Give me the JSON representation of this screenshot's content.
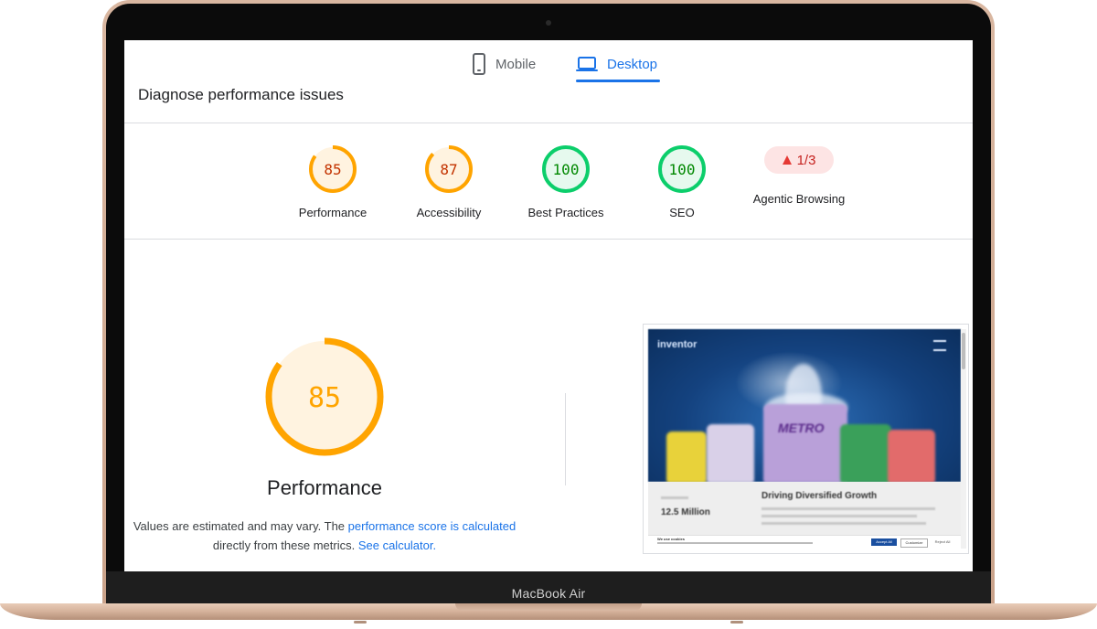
{
  "device": {
    "brand_label": "MacBook Air"
  },
  "tabs": [
    {
      "label": "Mobile",
      "icon": "phone-icon",
      "active": false
    },
    {
      "label": "Desktop",
      "icon": "laptop-icon",
      "active": true
    }
  ],
  "section_title": "Diagnose performance issues",
  "categories": [
    {
      "label": "Performance",
      "score": "85",
      "fraction": 0.85,
      "status": "average"
    },
    {
      "label": "Accessibility",
      "score": "87",
      "fraction": 0.87,
      "status": "average"
    },
    {
      "label": "Best Practices",
      "score": "100",
      "fraction": 1.0,
      "status": "pass"
    },
    {
      "label": "SEO",
      "score": "100",
      "fraction": 1.0,
      "status": "pass"
    },
    {
      "label": "Agentic Browsing",
      "score": "1/3",
      "status": "fail",
      "icon": "warning-triangle-icon"
    }
  ],
  "main": {
    "score": "85",
    "fraction": 0.85,
    "title": "Performance",
    "note_prefix": "Values are estimated and may vary. The ",
    "note_link1": "performance score is calculated",
    "note_middle": "directly from these metrics. ",
    "note_link2": "See calculator."
  },
  "colors": {
    "average_stroke": "#ffa400",
    "average_fill": "#fff3e0",
    "average_text": "#c33300",
    "pass_stroke": "#0cce6b",
    "pass_fill": "#e6f9ee",
    "pass_text": "#008800",
    "fail_fill": "#fde4e4",
    "fail_text": "#c5221f",
    "link": "#1a73e8"
  },
  "screenshot": {
    "logo": "inventor",
    "stat_label": "12.5 Million",
    "heading": "Driving Diversified Growth",
    "pack_label": "METRO",
    "cookie_title": "We use cookies",
    "cookie_accept": "Accept All",
    "cookie_customize": "Customize",
    "cookie_reject": "Reject All"
  }
}
